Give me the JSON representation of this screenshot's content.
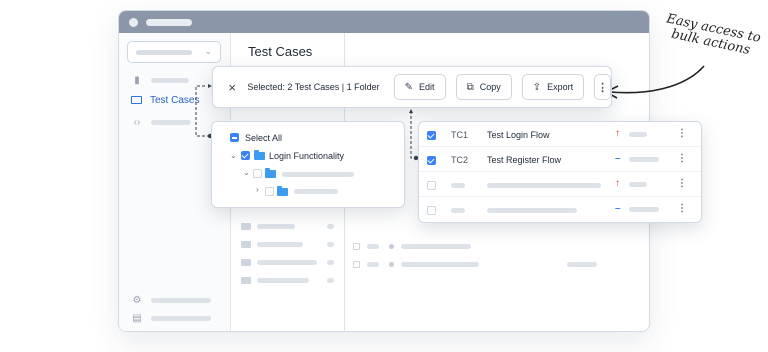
{
  "page": {
    "title": "Test Cases"
  },
  "sidebar": {
    "active_item": {
      "label": "Test Cases",
      "icon": "folder-icon"
    }
  },
  "actionbar": {
    "close_icon": "×",
    "selection_text": "Selected: 2 Test Cases | 1 Folder",
    "edit_label": "Edit",
    "edit_icon": "✎",
    "copy_label": "Copy",
    "copy_icon": "⧉",
    "export_label": "Export",
    "export_icon": "⇪",
    "more_icon": "⋮"
  },
  "tree": {
    "select_all_label": "Select All",
    "folder_label": "Login Functionality"
  },
  "test_cases": [
    {
      "id": "TC1",
      "title": "Test Login Flow",
      "checked": true,
      "priority": "↑"
    },
    {
      "id": "TC2",
      "title": "Test Register Flow",
      "checked": true,
      "priority": "–"
    },
    {
      "id": "",
      "title": "",
      "checked": false,
      "priority": "↑"
    },
    {
      "id": "",
      "title": "",
      "checked": false,
      "priority": "–"
    }
  ],
  "annotation": {
    "text": "Easy access to bulk actions"
  },
  "colors": {
    "accent": "#3b82f6",
    "priority_high": "#e53935",
    "priority_medium": "#3b82f6",
    "titlebar": "#8b97a8"
  }
}
